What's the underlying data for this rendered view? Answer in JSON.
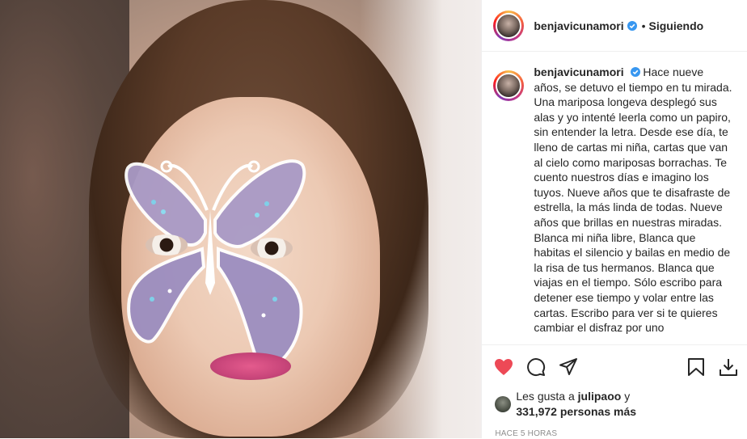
{
  "post": {
    "username": "benjavicunamori",
    "follow_status": "Siguiendo",
    "separator": "•",
    "caption_text": "Hace nueve años, se detuvo el tiempo en tu mirada. Una mariposa longeva desplegó sus alas y yo intenté leerla como un papiro, sin entender la letra. Desde ese día, te lleno de cartas mi niña, cartas que van al cielo como mariposas borrachas. Te cuento nuestros días e imagino los tuyos. Nueve años que te disafraste de estrella, la más linda de todas. Nueve años que brillas en nuestras miradas. Blanca mi niña libre, Blanca que habitas el silencio y bailas en medio de la risa de tus hermanos. Blanca que viajas en el tiempo. Sólo escribo para detener ese tiempo y volar entre las cartas. Escribo para ver si te quieres cambiar el disfraz por uno",
    "likes": {
      "prefix": "Les gusta a",
      "first_user": "julipaoo",
      "connector": "y",
      "others": "331,972 personas más"
    },
    "time_ago": "HACE 5 HORAS"
  },
  "colors": {
    "like_red": "#ed4956",
    "verified_blue": "#3897f0",
    "text": "#262626",
    "muted": "#8e8e8e"
  },
  "icons": [
    "verified-badge-icon",
    "heart-icon",
    "comment-icon",
    "share-icon",
    "bookmark-icon",
    "download-icon"
  ]
}
